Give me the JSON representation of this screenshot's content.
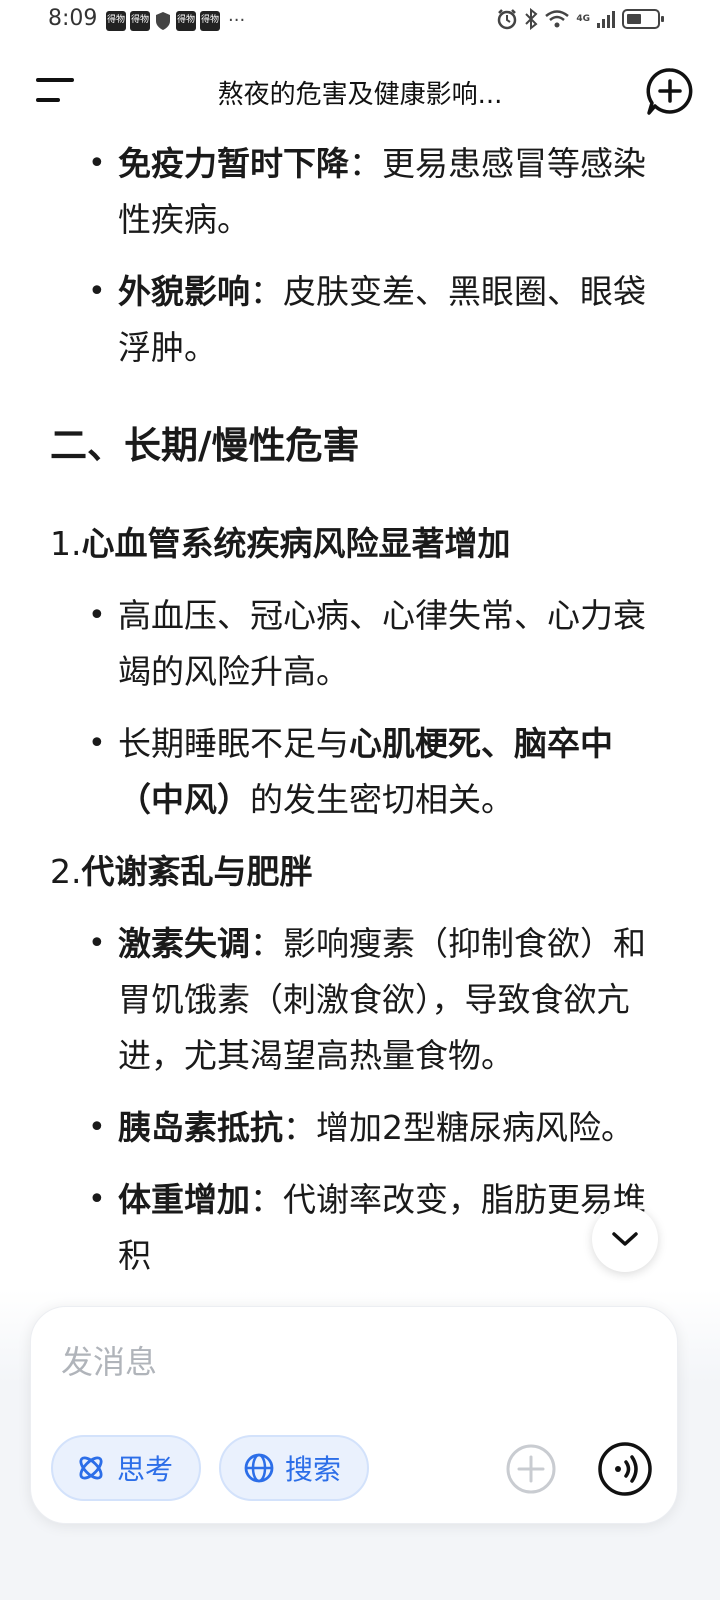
{
  "status_bar": {
    "time": "8:09",
    "notif_label": "得物",
    "more": "···",
    "network": "4G",
    "battery_level": 0.45
  },
  "top_bar": {
    "title": "熬夜的危害及健康影响..."
  },
  "content": {
    "b1_bold": "免疫力暂时下降",
    "b1_text": "：更易患感冒等感染性疾病。",
    "b2_bold": "外貌影响",
    "b2_text": "：皮肤变差、黑眼圈、眼袋浮肿。",
    "section2_heading": "二、长期/慢性危害",
    "item1_num": "1.",
    "item1_title": "心血管系统疾病风险显著增加",
    "i1b1_text": "高血压、冠心病、心律失常、心力衰竭的风险升高。",
    "i1b2_pre": "长期睡眠不足与",
    "i1b2_bold": "心肌梗死、脑卒中（中风）",
    "i1b2_post": "的发生密切相关。",
    "item2_num": "2.",
    "item2_title": "代谢紊乱与肥胖",
    "i2b1_bold": "激素失调",
    "i2b1_text": "：影响瘦素（抑制食欲）和胃饥饿素（刺激食欲），导致食欲亢进，尤其渴望高热量食物。",
    "i2b2_bold": "胰岛素抵抗",
    "i2b2_text": "：增加2型糖尿病风险。",
    "i2b3_bold": "体重增加",
    "i2b3_text": "：代谢率改变，脂肪更易堆积"
  },
  "composer": {
    "placeholder": "发消息",
    "chip_think": "思考",
    "chip_search": "搜索"
  },
  "icons": {
    "menu": "menu-icon",
    "new_chat": "new-chat-icon",
    "scroll_down": "chevron-down-icon",
    "think": "atom-icon",
    "search": "globe-icon",
    "plus": "plus-icon",
    "voice": "voice-icon"
  },
  "colors": {
    "accent": "#2c6ee8",
    "chip_bg": "#eaf1fd"
  }
}
